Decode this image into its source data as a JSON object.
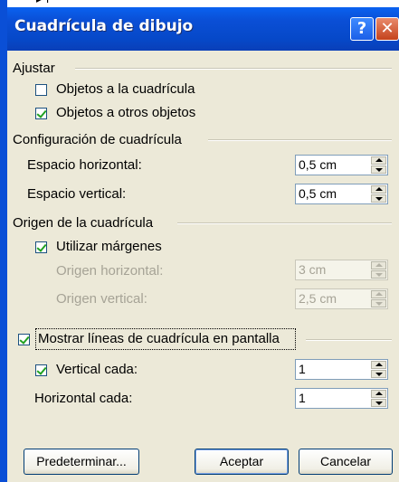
{
  "dialog": {
    "title": "Cuadrícula de dibujo",
    "help_icon": "help-icon",
    "help_glyph": "?",
    "close_icon": "close-icon",
    "close_glyph": "✕"
  },
  "ajustar": {
    "heading": "Ajustar",
    "snap_to_grid": {
      "label": "Objetos a la cuadrícula",
      "checked": false
    },
    "snap_to_objects": {
      "label": "Objetos a otros objetos",
      "checked": true
    }
  },
  "grid_config": {
    "heading": "Configuración de cuadrícula",
    "horizontal_spacing": {
      "label": "Espacio horizontal:",
      "value": "0,5 cm"
    },
    "vertical_spacing": {
      "label": "Espacio vertical:",
      "value": "0,5 cm"
    }
  },
  "grid_origin": {
    "heading": "Origen de la cuadrícula",
    "use_margins": {
      "label": "Utilizar márgenes",
      "checked": true
    },
    "horizontal_origin": {
      "label": "Origen horizontal:",
      "value": "3 cm",
      "disabled": true
    },
    "vertical_origin": {
      "label": "Origen vertical:",
      "value": "2,5 cm",
      "disabled": true
    }
  },
  "display": {
    "show_gridlines": {
      "label": "Mostrar líneas de cuadrícula en pantalla",
      "checked": true
    },
    "vertical_every": {
      "label": "Vertical cada:",
      "checked": true,
      "value": "1"
    },
    "horizontal_every": {
      "label": "Horizontal cada:",
      "value": "1"
    }
  },
  "buttons": {
    "default": "Predeterminar...",
    "ok": "Aceptar",
    "cancel": "Cancelar"
  },
  "colors": {
    "titlebar": "#0a4fd6",
    "dialog_bg": "#ece9d8",
    "disabled_text": "#a6a396",
    "check_mark": "#21a121"
  }
}
